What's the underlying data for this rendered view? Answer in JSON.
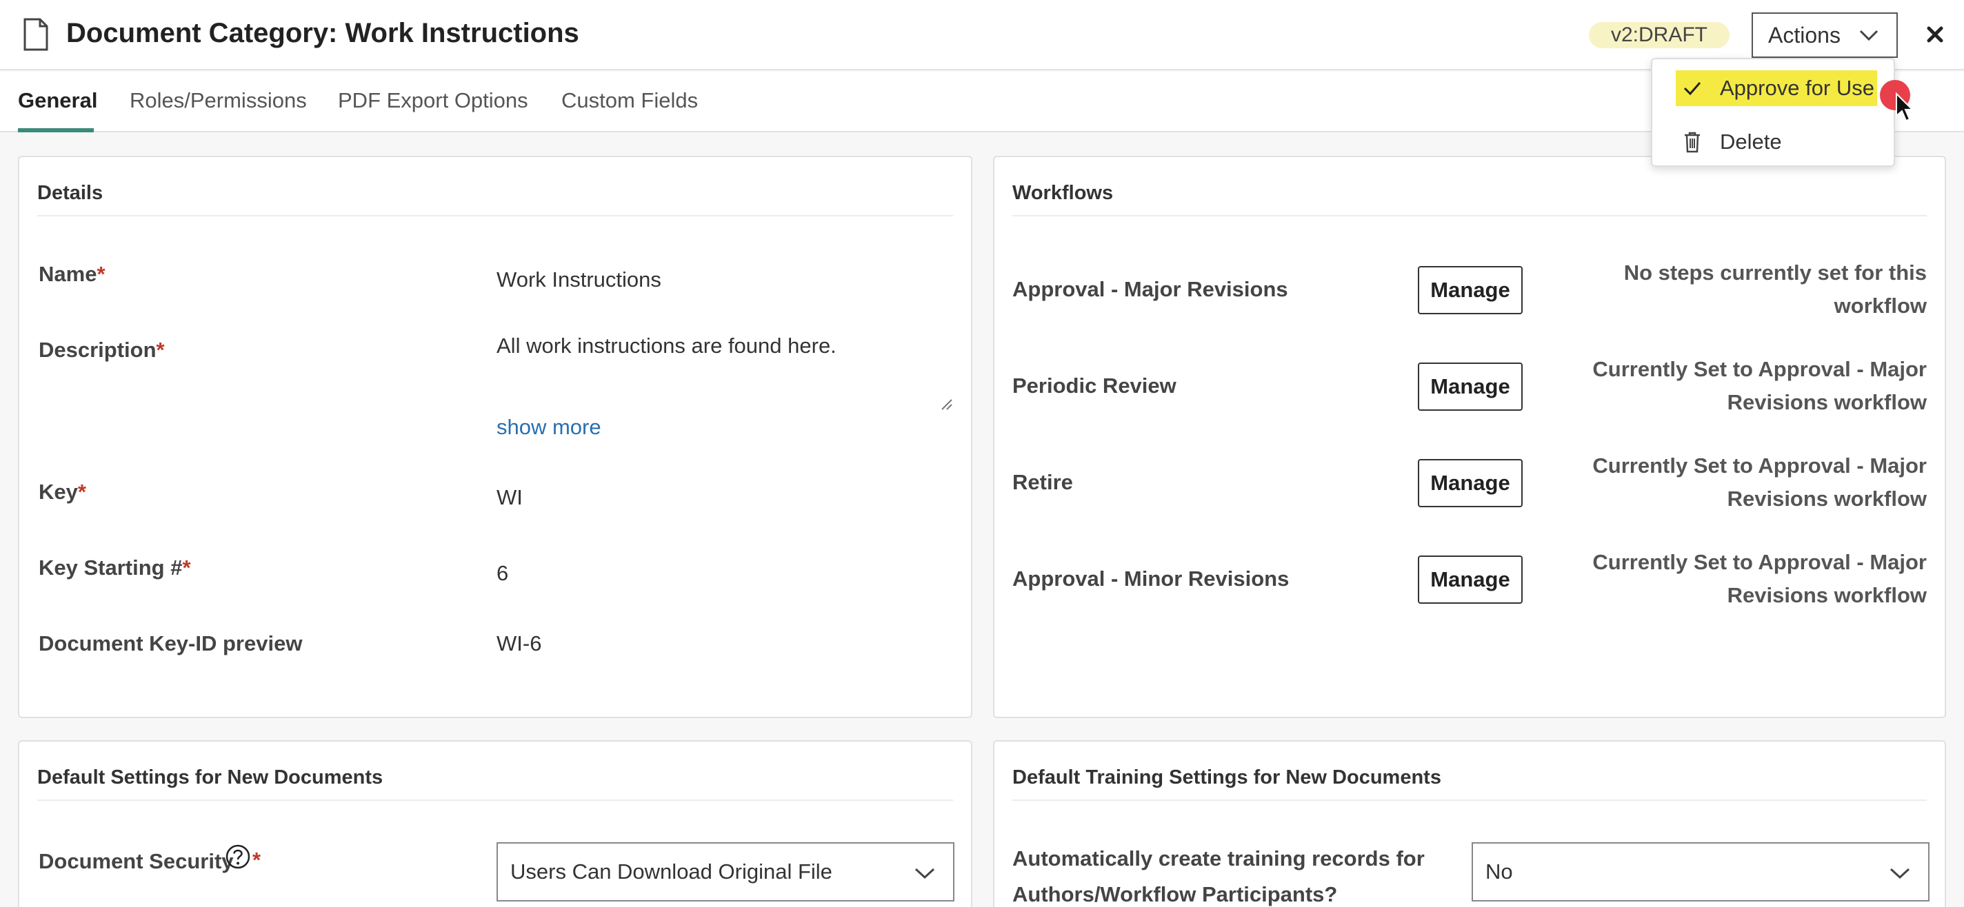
{
  "header": {
    "title": "Document Category: Work Instructions",
    "version_badge": "v2:DRAFT",
    "actions_label": "Actions",
    "icons": {
      "document": "document-icon",
      "chevron": "chevron-down-icon",
      "close": "close-icon"
    }
  },
  "tabs": [
    {
      "label": "General",
      "active": true
    },
    {
      "label": "Roles/Permissions",
      "active": false
    },
    {
      "label": "PDF Export Options",
      "active": false
    },
    {
      "label": "Custom Fields",
      "active": false
    }
  ],
  "actions_menu": {
    "items": [
      {
        "label": "Approve for Use",
        "icon": "check-icon",
        "highlighted": true
      },
      {
        "label": "Delete",
        "icon": "trash-icon",
        "highlighted": false
      }
    ]
  },
  "details": {
    "title": "Details",
    "name_label": "Name",
    "name_value": "Work Instructions",
    "description_label": "Description",
    "description_value": "All work instructions are found here.",
    "show_more": "show more",
    "key_label": "Key",
    "key_value": "WI",
    "key_start_label": "Key Starting #",
    "key_start_value": "6",
    "preview_label": "Document Key-ID preview",
    "preview_value": "WI-6",
    "required_mark": "*"
  },
  "workflows": {
    "title": "Workflows",
    "manage_label": "Manage",
    "rows": [
      {
        "name": "Approval - Major Revisions",
        "status": "No steps currently set for this workflow"
      },
      {
        "name": "Periodic Review",
        "status": "Currently Set to Approval - Major Revisions workflow"
      },
      {
        "name": "Retire",
        "status": "Currently Set to Approval - Major Revisions workflow"
      },
      {
        "name": "Approval - Minor Revisions",
        "status": "Currently Set to Approval - Major Revisions workflow"
      }
    ]
  },
  "default_settings": {
    "title": "Default Settings for New Documents",
    "security_label": "Document Security",
    "security_value": "Users Can Download Original File",
    "required_mark": "*"
  },
  "training_settings": {
    "title": "Default Training Settings for New Documents",
    "auto_label_line1": "Automatically create training records for",
    "auto_label_line2": "Authors/Workflow Participants?",
    "auto_value": "No"
  },
  "colors": {
    "accent": "#3c8a7a",
    "highlight": "#f5ea42",
    "required": "#c0392b",
    "link": "#2a6fb0",
    "badge_bg": "#f8f3c4"
  }
}
